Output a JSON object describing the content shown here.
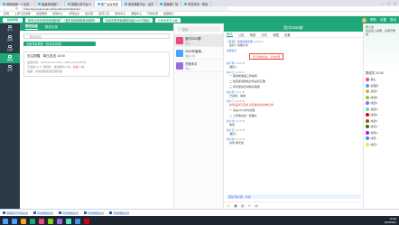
{
  "browser": {
    "tabs": [
      {
        "label": "网络营销一个全员...",
        "active": false
      },
      {
        "label": "超级单量推广...",
        "active": false
      },
      {
        "label": "数据分析平台 0",
        "active": false
      },
      {
        "label": "推广后台系统",
        "active": true
      },
      {
        "label": "电商课程平台 - 会员",
        "active": false
      },
      {
        "label": "直播推广站",
        "active": false
      },
      {
        "label": "项目任务 - 规划",
        "active": false
      }
    ],
    "url": "https://qun.kuai-code.net/workbench/chat/index",
    "bookmarks": [
      "应用",
      "上学习资源库",
      "百度翻译",
      "营销中心",
      "学院后台",
      "知识库",
      "运营工具",
      "素材中心",
      "课程中心",
      "代码仓库",
      "数据统计"
    ]
  },
  "app_header": {
    "logo": "快码学院",
    "tip_1": "带学业务好用的营销配置？（直在营销课程第讲推荐）",
    "tip_2": "见到这里营销课程页面(Ctrl+F搜索)",
    "tip_3": "点我看更多功能",
    "right_items": [
      "帮助",
      "设置",
      "退出"
    ]
  },
  "sidebar": {
    "items": [
      {
        "label": "学习",
        "active": false
      },
      {
        "label": "客服",
        "active": false
      },
      {
        "label": "社群",
        "active": false
      },
      {
        "label": "群发",
        "active": true
      },
      {
        "label": "设置",
        "active": false
      }
    ]
  },
  "left_panel": {
    "tabs": [
      "群发消息",
      "群发记录"
    ],
    "search_placeholder": "群发内容",
    "section_label": "全部消息群发（仅本店有效）",
    "card": {
      "title": "关注提醒 · 周日发送 10:00",
      "rows": [
        "发送时间：2020-03-10 10:00 - 2020-03-12 09:00",
        "已发送 11 人  未回复：发送成功 6 条，失败 0 条",
        "提醒：请勿频繁发送营销内容"
      ],
      "highlight": "失败 0 条"
    }
  },
  "conversations": {
    "search_placeholder": "搜索",
    "items": [
      {
        "name": "室内3192群",
        "sub": "您好 …",
        "active": true,
        "color": "#e94b7a"
      },
      {
        "name": "2020年营销...",
        "sub": "[图片] 新...",
        "active": false,
        "color": "#4aa3ff"
      },
      {
        "name": "艺家未平",
        "sub": "你好...",
        "active": false,
        "color": "#9c6adf"
      }
    ]
  },
  "chat": {
    "title": "室内3192群",
    "tabs": [
      "聊天",
      "公告",
      "相册",
      "文件",
      "收藏",
      "设置"
    ],
    "messages": [
      {
        "who": "【客服】 精准搜推助理",
        "time": "14:04:22",
        "body": "您好了请看分享",
        "emphasis": false
      },
      {
        "who": "系统提示",
        "time": "",
        "body": "您已添加好友 · 点击这里",
        "emphasis": true
      },
      {
        "who": "客户甲",
        "time": "14:05:20",
        "body": "[图片]",
        "emphasis": false
      },
      {
        "who": "客户乙",
        "time": "14:06:11",
        "body": "一 使用前准备工作指导",
        "emphasis": false
      },
      {
        "who": "",
        "time": "",
        "body": "二 检查使用群发文件是否正确",
        "emphasis": false
      },
      {
        "who": "",
        "time": "",
        "body": "三 有问题请及时联系客服",
        "emphasis": false
      },
      {
        "who": "客户丙",
        "time": "14:07:08",
        "body": "已完成，谢谢",
        "emphasis": false
      },
      {
        "who": "客户丁",
        "time": "14:08:40",
        "body": "新增品牌已完成 请查看最新排单记录",
        "emphasis": true
      },
      {
        "who": "",
        "time": "",
        "body": "一 请在24小时内处理",
        "emphasis": false
      },
      {
        "who": "",
        "time": "",
        "body": "二 上传素材后一起确认",
        "emphasis": false
      },
      {
        "who": "客户戊",
        "time": "14:12:55",
        "body": "收到",
        "emphasis": false
      },
      {
        "who": "客户己",
        "time": "14:13:30",
        "body": "[图片]",
        "emphasis": false
      },
      {
        "who": "客户庚",
        "time": "14:15:02",
        "body": "好的 明天发",
        "emphasis": false
      }
    ],
    "reply_bar": "回复 客户庚：好的"
  },
  "right_panel": {
    "announcement_label": "群公告",
    "announcement": "欢迎加入本群，请遵守群规",
    "member_title": "群成员 21/45",
    "members": [
      {
        "name": "群主",
        "color": "#e94b7a"
      },
      {
        "name": "管理员",
        "color": "#4aa3ff"
      },
      {
        "name": "成员A",
        "color": "#f5a623"
      },
      {
        "name": "成员B",
        "color": "#7ed321"
      },
      {
        "name": "成员C",
        "color": "#9c6adf"
      },
      {
        "name": "成员D",
        "color": "#50e3c2"
      },
      {
        "name": "成员E",
        "color": "#d0021b"
      },
      {
        "name": "成员F",
        "color": "#8b572a"
      },
      {
        "name": "成员G",
        "color": "#417505"
      },
      {
        "name": "成员H",
        "color": "#bd10e0"
      },
      {
        "name": "成员I",
        "color": "#4a90e2"
      },
      {
        "name": "成员J",
        "color": "#f8e71c"
      }
    ]
  },
  "taskbar": {
    "strip": [
      "课程首页管理第讲",
      "营销课程第讲",
      "营销课程第讲",
      "营销课程第讲",
      "营销课程第讲"
    ],
    "apps": [
      "#4aa3ff",
      "#f5a623",
      "#1fa77a",
      "#e94b7a",
      "#7ed321",
      "#9c6adf",
      "#50e3c2",
      "#4a90e2",
      "#d0021b"
    ],
    "time": "11:00",
    "date": "2020/3/11"
  }
}
